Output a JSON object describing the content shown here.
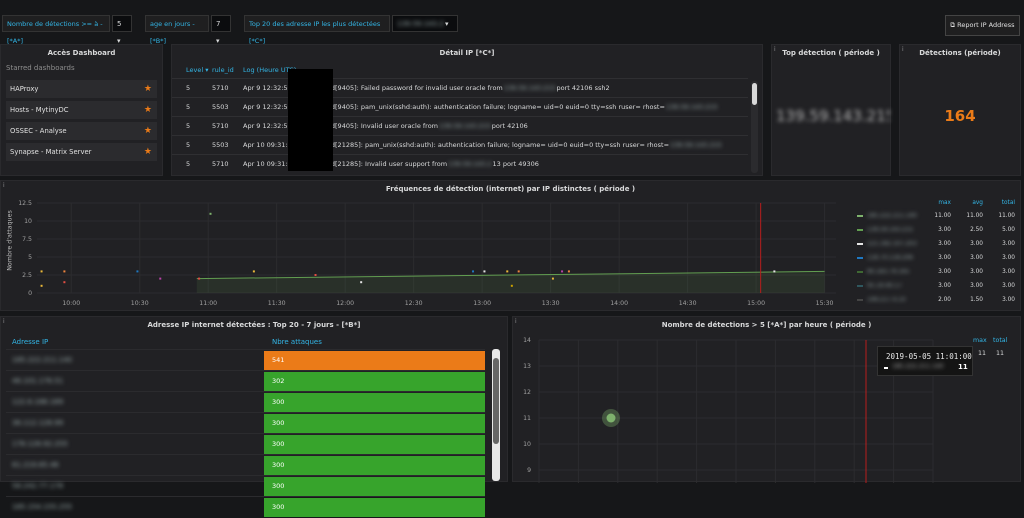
{
  "toolbar": {
    "var1_label": "Nombre de détections >= à - [*A*]",
    "var1_value": "5",
    "var2_label": "age en jours - [*B*]",
    "var2_value": "7",
    "var3_label": "Top 20 des adresse IP les plus détectées [*C*]",
    "var3_value": "139.59.143.215",
    "report_button": "Report IP Address"
  },
  "dashboard_panel": {
    "title": "Accès Dashboard",
    "subtitle": "Starred dashboards",
    "items": [
      "HAProxy",
      "Hosts - MytinyDC",
      "OSSEC - Analyse",
      "Synapse - Matrix Server"
    ]
  },
  "detail_panel": {
    "title": "Détail IP [*C*]",
    "columns": [
      "Level",
      "rule_id",
      "Log (Heure UTC)"
    ],
    "rows": [
      {
        "level": "5",
        "rule": "5710",
        "time": "Apr 9 12:32:57",
        "msg_a": "sshd[9405]: Failed password for invalid user oracle from",
        "ip": "139.59.143.215",
        "msg_b": "port 42106 ssh2"
      },
      {
        "level": "5",
        "rule": "5503",
        "time": "Apr 9 12:32:55",
        "msg_a": "sshd[9405]: pam_unix(sshd:auth): authentication failure; logname= uid=0 euid=0 tty=ssh ruser= rhost=",
        "ip": "139.59.143.215",
        "msg_b": ""
      },
      {
        "level": "5",
        "rule": "5710",
        "time": "Apr 9 12:32:55",
        "msg_a": "sshd[9405]: Invalid user oracle from",
        "ip": "139.59.143.215",
        "msg_b": "port 42106"
      },
      {
        "level": "5",
        "rule": "5503",
        "time": "Apr 10 09:31:53",
        "msg_a": "sshd[21285]: pam_unix(sshd:auth): authentication failure; logname= uid=0 euid=0 tty=ssh ruser= rhost=",
        "ip": "139.59.143.215",
        "msg_b": ""
      },
      {
        "level": "5",
        "rule": "5710",
        "time": "Apr 10 09:31:53",
        "msg_a": "sshd[21285]: Invalid user support from",
        "ip": "139.59.143.2",
        "msg_b": "13 port 49306"
      }
    ]
  },
  "top_detection": {
    "title": "Top détection ( période )",
    "value": "139.59.143.215"
  },
  "detections": {
    "title": "Détections (période)",
    "value": "164"
  },
  "freq_panel": {
    "title": "Fréquences de détection (internet) par IP distinctes ( période )",
    "ylabel": "Nombre d'attaques",
    "legend_headers": {
      "max": "max",
      "avg": "avg",
      "total": "total"
    },
    "legend": [
      {
        "name": "185.222.211.140",
        "color": "#7eb26d",
        "max": "11.00",
        "avg": "11.00",
        "total": "11.00"
      },
      {
        "name": "139.59.143.215",
        "color": "#629e51",
        "max": "3.00",
        "avg": "2.50",
        "total": "5.00"
      },
      {
        "name": "121.182.107.203",
        "color": "#e5e5e5",
        "max": "3.00",
        "avg": "3.00",
        "total": "3.00"
      },
      {
        "name": "118.70.118.206",
        "color": "#1f78c1",
        "max": "3.00",
        "avg": "3.00",
        "total": "3.00"
      },
      {
        "name": "80.183.79.165",
        "color": "#3f6833",
        "max": "3.00",
        "avg": "3.00",
        "total": "3.00"
      },
      {
        "name": "95.19.40.17",
        "color": "#2f575e",
        "max": "3.00",
        "avg": "3.00",
        "total": "3.00"
      },
      {
        "name": "149.217.4.10",
        "color": "#444444",
        "max": "2.00",
        "avg": "1.50",
        "total": "3.00"
      }
    ]
  },
  "chart_data": {
    "type": "scatter",
    "x": [
      "10:00",
      "10:30",
      "11:00",
      "11:30",
      "12:00",
      "12:30",
      "13:00",
      "13:30",
      "14:00",
      "14:30",
      "15:00",
      "15:30"
    ],
    "y_ticks": [
      "0",
      "2.5",
      "5",
      "7.5",
      "10",
      "12.5"
    ],
    "ylim": [
      0,
      12.5
    ],
    "xlim": [
      "09:45",
      "15:35"
    ],
    "points": [
      {
        "t": "09:47",
        "y": 3,
        "color": "#eab839"
      },
      {
        "t": "09:47",
        "y": 1,
        "color": "#eab839"
      },
      {
        "t": "09:57",
        "y": 3,
        "color": "#ef843c"
      },
      {
        "t": "09:57",
        "y": 1.5,
        "color": "#e24d42"
      },
      {
        "t": "10:29",
        "y": 3,
        "color": "#1f78c1"
      },
      {
        "t": "10:39",
        "y": 2,
        "color": "#ba43a9"
      },
      {
        "t": "10:56",
        "y": 2,
        "color": "#e24d42"
      },
      {
        "t": "11:01",
        "y": 11,
        "color": "#7eb26d"
      },
      {
        "t": "11:20",
        "y": 3,
        "color": "#eab839"
      },
      {
        "t": "11:47",
        "y": 2.5,
        "color": "#e24d42"
      },
      {
        "t": "12:07",
        "y": 1.5,
        "color": "#e5e5e5"
      },
      {
        "t": "12:56",
        "y": 3,
        "color": "#1f78c1"
      },
      {
        "t": "13:01",
        "y": 3,
        "color": "#e5e5e5"
      },
      {
        "t": "13:11",
        "y": 3,
        "color": "#eab839"
      },
      {
        "t": "13:16",
        "y": 3,
        "color": "#ef843c"
      },
      {
        "t": "13:13",
        "y": 1,
        "color": "#cca300"
      },
      {
        "t": "13:31",
        "y": 2,
        "color": "#eab839"
      },
      {
        "t": "13:35",
        "y": 3,
        "color": "#ba43a9"
      },
      {
        "t": "13:38",
        "y": 3,
        "color": "#ef843c"
      },
      {
        "t": "15:08",
        "y": 3,
        "color": "#e5e5e5"
      }
    ],
    "trend": {
      "from": {
        "t": "10:55",
        "y": 2
      },
      "to": {
        "t": "15:30",
        "y": 3
      },
      "color": "#629e51"
    },
    "time_marker": "15:02"
  },
  "ip_panel": {
    "title": "Adresse IP internet détectées : Top 20 - 7 jours - [*B*]",
    "col_ip": "Adresse IP",
    "col_count": "Nbre attaques",
    "rows": [
      {
        "ip": "185.222.211.140",
        "count": "541",
        "color": "#eb7b18"
      },
      {
        "ip": "46.101.176.51",
        "count": "302",
        "color": "#37a42c"
      },
      {
        "ip": "122.6.188.189",
        "count": "300",
        "color": "#37a42c"
      },
      {
        "ip": "36.112.128.99",
        "count": "300",
        "color": "#37a42c"
      },
      {
        "ip": "178.128.92.255",
        "count": "300",
        "color": "#37a42c"
      },
      {
        "ip": "61.219.65.46",
        "count": "300",
        "color": "#37a42c"
      },
      {
        "ip": "58.242.77.178",
        "count": "300",
        "color": "#37a42c"
      },
      {
        "ip": "185.154.155.255",
        "count": "300",
        "color": "#37a42c"
      }
    ]
  },
  "hourly_panel": {
    "title": "Nombre de détections > 5 [*A*] par heure ( période )",
    "y_ticks": [
      "14",
      "13",
      "12",
      "11",
      "10",
      "9"
    ],
    "legend_max": "max",
    "legend_total": "total",
    "legend_max_val": "11",
    "legend_total_val": "11",
    "tooltip_time": "2019-05-05 11:01:00",
    "tooltip_series": "185.222.211.140",
    "tooltip_value": "11",
    "point_value": 11
  }
}
